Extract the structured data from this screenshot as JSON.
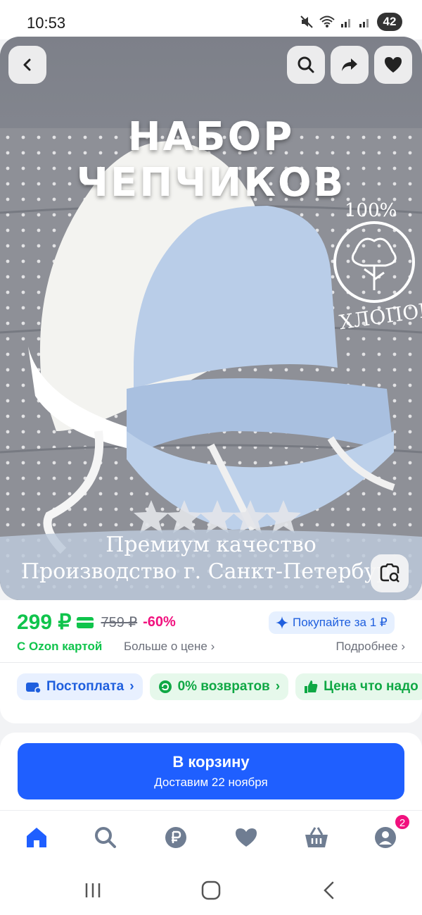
{
  "status": {
    "time": "10:53",
    "battery": "42"
  },
  "hero": {
    "title": "НАБОР ЧЕПЧИКОВ",
    "cotton_percent": "100%",
    "cotton_word": "ХЛОПОК",
    "banner_line_1": "Премиум качество",
    "banner_line_2": "Производство  г. Санкт-Петербург"
  },
  "price": {
    "current": "299 ₽",
    "old": "759 ₽",
    "discount": "-60%",
    "promo": "Покупайте за 1 ₽",
    "ozon_card": "С Ozon картой",
    "more_about_price": "Больше о цене",
    "details": "Подробнее"
  },
  "chips": [
    {
      "label": "Постоплата"
    },
    {
      "label": "0% возвратов"
    },
    {
      "label": "Цена что надо"
    }
  ],
  "cart": {
    "label": "В корзину",
    "delivery": "Доставим 22 ноября"
  },
  "tabbar": {
    "profile_badge": "2"
  },
  "colors": {
    "accent": "#1f5fff",
    "price_green": "#10c44c",
    "discount_pink": "#f1117e"
  }
}
